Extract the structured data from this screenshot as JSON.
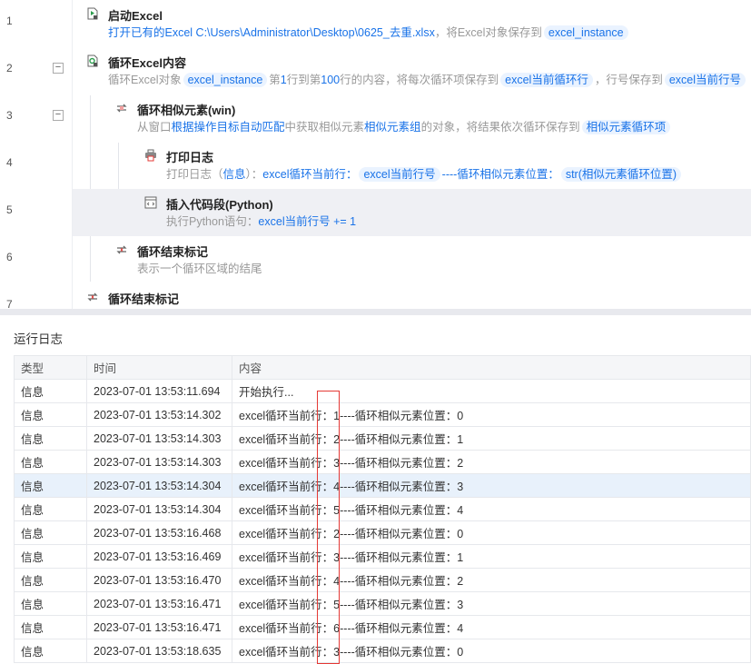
{
  "flow": {
    "lines": [
      "1",
      "2",
      "3",
      "4",
      "5",
      "6",
      "7"
    ],
    "steps": [
      {
        "title": "启动Excel",
        "icon": "excel-launch-icon",
        "desc": [
          {
            "t": "打开已有的Excel C:\\Users\\Administrator\\Desktop\\0625_去重.xlsx",
            "k": "link"
          },
          {
            "t": "，将Excel对象保存到",
            "k": "plain"
          },
          {
            "t": "excel_instance",
            "k": "chip"
          }
        ]
      },
      {
        "title": "循环Excel内容",
        "icon": "excel-loop-icon",
        "desc": [
          {
            "t": "循环Excel对象",
            "k": "plain"
          },
          {
            "t": "excel_instance",
            "k": "chip"
          },
          {
            "t": "第",
            "k": "plain"
          },
          {
            "t": "1",
            "k": "link"
          },
          {
            "t": "行到第",
            "k": "plain"
          },
          {
            "t": "100",
            "k": "link"
          },
          {
            "t": "行的内容，将每次循环项保存到",
            "k": "plain"
          },
          {
            "t": "excel当前循环行",
            "k": "chip"
          },
          {
            "t": "，行号保存到",
            "k": "plain"
          },
          {
            "t": "excel当前行号",
            "k": "chip"
          }
        ]
      },
      {
        "title": "循环相似元素(win)",
        "icon": "loop-similar-icon",
        "desc": [
          {
            "t": "从窗口",
            "k": "plain"
          },
          {
            "t": "根据操作目标自动匹配",
            "k": "link"
          },
          {
            "t": "中获取相似元素",
            "k": "plain"
          },
          {
            "t": "相似元素组",
            "k": "link"
          },
          {
            "t": "的对象，将结果依次循环保存到",
            "k": "plain"
          },
          {
            "t": "相似元素循环项",
            "k": "chip"
          }
        ]
      },
      {
        "title": "打印日志",
        "icon": "print-log-icon",
        "desc": [
          {
            "t": "打印日志（",
            "k": "plain"
          },
          {
            "t": "信息",
            "k": "link"
          },
          {
            "t": "）：",
            "k": "plain"
          },
          {
            "t": "excel循环当前行：",
            "k": "link"
          },
          {
            "t": "excel当前行号",
            "k": "chip"
          },
          {
            "t": "----循环相似元素位置：",
            "k": "link"
          },
          {
            "t": "str(相似元素循环位置)",
            "k": "chip"
          }
        ]
      },
      {
        "title": "插入代码段(Python)",
        "icon": "code-icon",
        "desc": [
          {
            "t": "执行Python语句：",
            "k": "plain"
          },
          {
            "t": "excel当前行号 += 1",
            "k": "link"
          }
        ]
      },
      {
        "title": "循环结束标记",
        "icon": "loop-end-icon",
        "desc": [
          {
            "t": "表示一个循环区域的结尾",
            "k": "plain"
          }
        ]
      },
      {
        "title": "循环结束标记",
        "icon": "loop-end-icon",
        "desc": []
      }
    ]
  },
  "log": {
    "title": "运行日志",
    "columns": [
      "类型",
      "时间",
      "内容"
    ],
    "rows": [
      [
        "信息",
        "2023-07-01 13:53:11.694",
        "开始执行..."
      ],
      [
        "信息",
        "2023-07-01 13:53:14.302",
        "excel循环当前行：1----循环相似元素位置：0"
      ],
      [
        "信息",
        "2023-07-01 13:53:14.303",
        "excel循环当前行：2----循环相似元素位置：1"
      ],
      [
        "信息",
        "2023-07-01 13:53:14.303",
        "excel循环当前行：3----循环相似元素位置：2"
      ],
      [
        "信息",
        "2023-07-01 13:53:14.304",
        "excel循环当前行：4----循环相似元素位置：3"
      ],
      [
        "信息",
        "2023-07-01 13:53:14.304",
        "excel循环当前行：5----循环相似元素位置：4"
      ],
      [
        "信息",
        "2023-07-01 13:53:16.468",
        "excel循环当前行：2----循环相似元素位置：0"
      ],
      [
        "信息",
        "2023-07-01 13:53:16.469",
        "excel循环当前行：3----循环相似元素位置：1"
      ],
      [
        "信息",
        "2023-07-01 13:53:16.470",
        "excel循环当前行：4----循环相似元素位置：2"
      ],
      [
        "信息",
        "2023-07-01 13:53:16.471",
        "excel循环当前行：5----循环相似元素位置：3"
      ],
      [
        "信息",
        "2023-07-01 13:53:16.471",
        "excel循环当前行：6----循环相似元素位置：4"
      ],
      [
        "信息",
        "2023-07-01 13:53:18.635",
        "excel循环当前行：3----循环相似元素位置：0"
      ]
    ],
    "highlighted_row": 4
  }
}
